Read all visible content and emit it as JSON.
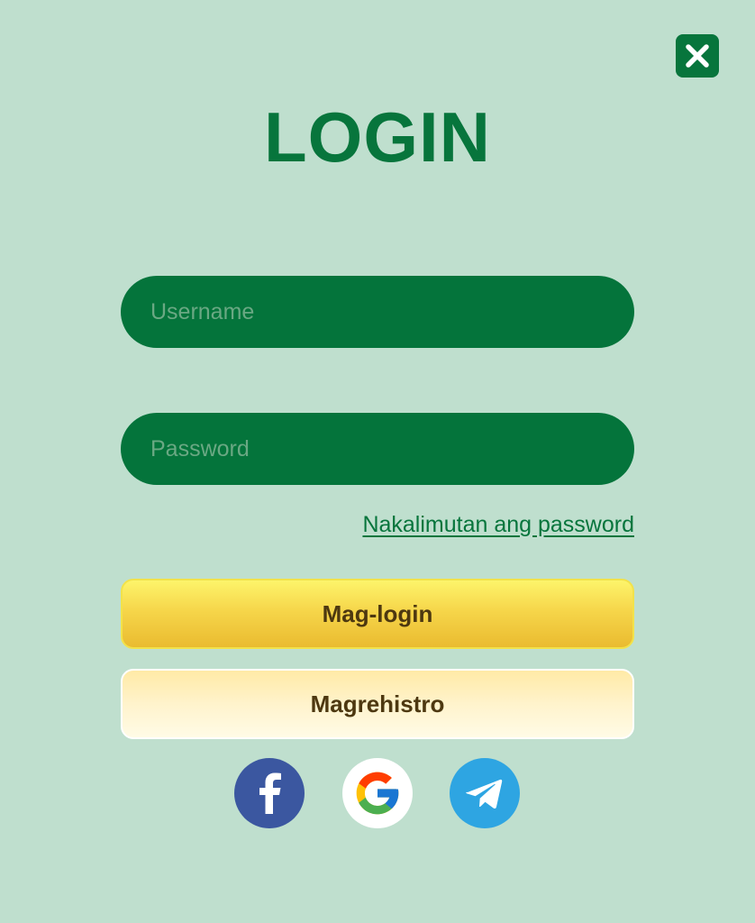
{
  "title": "LOGIN",
  "username": {
    "placeholder": "Username",
    "value": ""
  },
  "password": {
    "placeholder": "Password",
    "value": ""
  },
  "forgot_password_label": "Nakalimutan ang password",
  "login_button_label": "Mag-login",
  "register_button_label": "Magrehistro",
  "social_logins": [
    {
      "name": "facebook-icon",
      "color": "#3b57a0"
    },
    {
      "name": "google-icon",
      "color": "#ffffff"
    },
    {
      "name": "telegram-icon",
      "color": "#2ea5e2"
    }
  ],
  "colors": {
    "background": "#bfdfce",
    "primary_green": "#07753c",
    "field_green": "#04743b",
    "login_button_gold": "#f6d64a",
    "register_button_cream": "#fff3cc",
    "button_text": "#4d3810"
  }
}
